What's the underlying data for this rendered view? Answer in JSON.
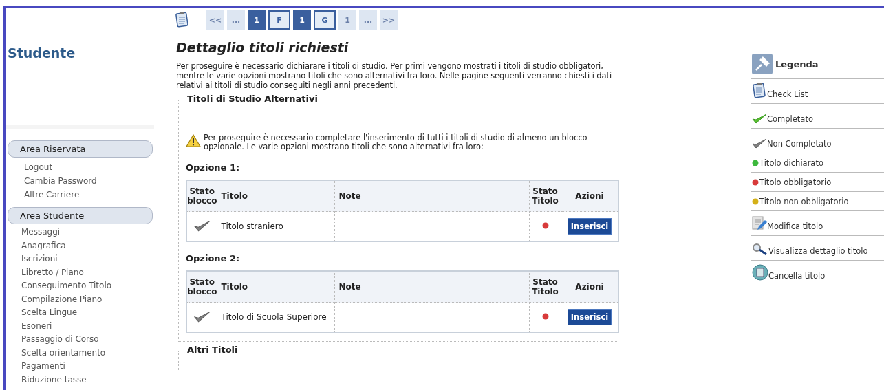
{
  "sidebar": {
    "title": "Studente",
    "sections": [
      {
        "heading": "Area Riservata",
        "items": [
          "Logout",
          "Cambia Password",
          "Altre Carriere"
        ]
      },
      {
        "heading": "Area Studente",
        "items": [
          "Messaggi",
          "Anagrafica",
          "Iscrizioni",
          "Libretto / Piano",
          "Conseguimento Titolo",
          "Compilazione Piano",
          "Scelta Lingue",
          "Esoneri",
          "Passaggio di Corso",
          "Scelta orientamento",
          "Pagamenti",
          "Riduzione tasse"
        ]
      }
    ]
  },
  "pager": [
    {
      "label": "<<",
      "kind": "plain"
    },
    {
      "label": "...",
      "kind": "plain"
    },
    {
      "label": "1",
      "kind": "current"
    },
    {
      "label": "F",
      "kind": "step"
    },
    {
      "label": "1",
      "kind": "current"
    },
    {
      "label": "G",
      "kind": "step"
    },
    {
      "label": "1",
      "kind": "plain"
    },
    {
      "label": "...",
      "kind": "plain"
    },
    {
      "label": ">>",
      "kind": "plain"
    }
  ],
  "main": {
    "title": "Dettaglio titoli richiesti",
    "intro": "Per proseguire è necessario dichiarare i titoli di studio. Per primi vengono mostrati i titoli di studio obbligatori, mentre le varie opzioni mostrano titoli che sono alternativi fra loro. Nelle pagine seguenti verranno chiesti i dati relativi ai titoli di studio conseguiti negli anni precedenti.",
    "fieldset": {
      "legend": "Titoli di Studio Alternativi",
      "warning": "Per proseguire è necessario completare l'inserimento di tutti i titoli di studio di almeno un blocco opzionale. Le varie opzioni mostrano titoli che sono alternativi fra loro:",
      "options": [
        {
          "heading": "Opzione 1:",
          "columns": [
            "Stato blocco",
            "Titolo",
            "Note",
            "Stato Titolo",
            "Azioni"
          ],
          "rows": [
            {
              "completed": false,
              "title": "Titolo straniero",
              "color": "#d83a3a",
              "action": "Inserisci"
            }
          ]
        },
        {
          "heading": "Opzione 2:",
          "columns": [
            "Stato blocco",
            "Titolo",
            "Note",
            "Stato Titolo",
            "Azioni"
          ],
          "rows": [
            {
              "completed": false,
              "title": "Titolo di Scuola Superiore",
              "color": "#d83a3a",
              "action": "Inserisci"
            }
          ]
        }
      ]
    },
    "second_fieldset": {
      "legend": "Altri Titoli"
    }
  },
  "legend": {
    "title": "Legenda",
    "items": [
      {
        "kind": "clipboard",
        "label": "Check List"
      },
      {
        "kind": "check",
        "label": "Completato"
      },
      {
        "kind": "check-gray",
        "label": "Non Completato"
      },
      {
        "kind": "dot",
        "color": "#3cb83c",
        "label": "Titolo dichiarato"
      },
      {
        "kind": "dot",
        "color": "#d83a3a",
        "label": "Titolo obbligatorio"
      },
      {
        "kind": "dot",
        "color": "#d4b018",
        "label": "Titolo non obbligatorio"
      },
      {
        "kind": "edit",
        "label": "Modifica titolo"
      },
      {
        "kind": "search",
        "label": "Visualizza dettaglio titolo"
      },
      {
        "kind": "delete",
        "label": "Cancella titolo"
      }
    ]
  }
}
